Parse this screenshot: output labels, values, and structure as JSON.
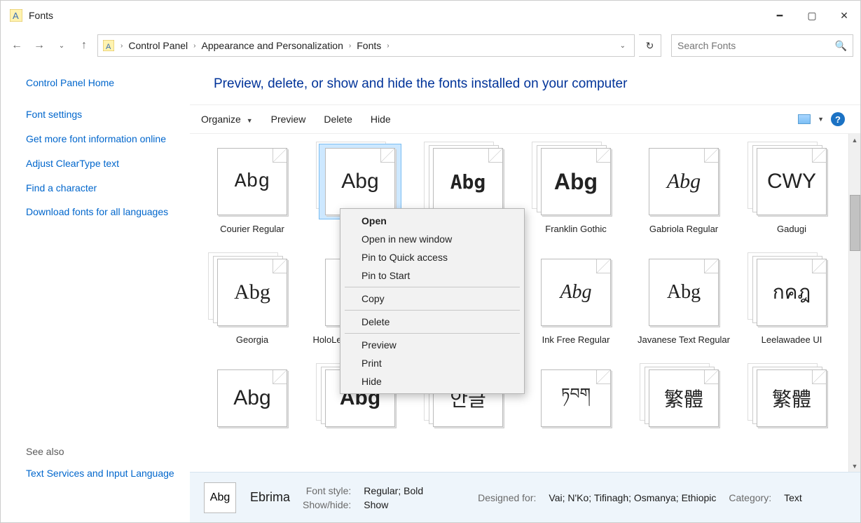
{
  "window": {
    "title": "Fonts"
  },
  "breadcrumb": {
    "items": [
      "Control Panel",
      "Appearance and Personalization",
      "Fonts"
    ]
  },
  "search": {
    "placeholder": "Search Fonts"
  },
  "sidebar": {
    "home": "Control Panel Home",
    "links": [
      "Font settings",
      "Get more font information online",
      "Adjust ClearType text",
      "Find a character",
      "Download fonts for all languages"
    ],
    "see_also_label": "See also",
    "see_also": "Text Services and Input Language"
  },
  "heading": "Preview, delete, or show and hide the fonts installed on your computer",
  "toolbar": {
    "organize": "Organize",
    "preview": "Preview",
    "delete": "Delete",
    "hide": "Hide"
  },
  "fonts_row1": [
    {
      "sample": "Abg",
      "label": "Courier Regular",
      "stack": false,
      "style": "font-family: 'Courier New', monospace; font-size:28px;"
    },
    {
      "sample": "Abg",
      "label": "",
      "stack": true,
      "selected": true,
      "style": "font-family: Arial; font-size:30px;"
    },
    {
      "sample": "Abg",
      "label": "",
      "stack": true,
      "style": "font-family: monospace; font-weight:bold; font-size:28px;"
    },
    {
      "sample": "Abg",
      "label": "Franklin Gothic",
      "stack": true,
      "style": "font-family: 'Franklin Gothic Medium', Arial; font-weight:bold; font-size:32px;"
    },
    {
      "sample": "Abg",
      "label": "Gabriola Regular",
      "stack": false,
      "style": "font-family: Gabriola, serif; font-style:italic; font-size:30px;"
    },
    {
      "sample": "CWY",
      "label": "Gadugi",
      "stack": true,
      "style": "font-family: Arial; font-size:30px;"
    }
  ],
  "fonts_row2": [
    {
      "sample": "Abg",
      "label": "Georgia",
      "stack": true,
      "style": "font-family: Georgia, serif; font-size:30px;"
    },
    {
      "sample": "A",
      "label": "HoloLens MDL2 Assets",
      "stack": false,
      "style": "font-family: Arial; font-size:30px;"
    },
    {
      "sample": "",
      "label": "",
      "stack": false,
      "style": ""
    },
    {
      "sample": "Abg",
      "label": "Ink Free Regular",
      "stack": false,
      "style": "font-family: 'Comic Sans MS', cursive; font-style:italic; font-size:28px;"
    },
    {
      "sample": "Abg",
      "label": "Javanese Text Regular",
      "stack": false,
      "style": "font-family: Georgia, serif; font-size:28px;"
    },
    {
      "sample": "กคฎ",
      "label": "Leelawadee UI",
      "stack": true,
      "style": "font-family: 'Leelawadee UI', Arial; font-size:28px;"
    }
  ],
  "fonts_row3": [
    {
      "sample": "Abg",
      "style": "font-family: Arial; font-size:30px;",
      "stack": false
    },
    {
      "sample": "Abg",
      "style": "font-family: Arial; font-weight:bold; font-size:30px;",
      "stack": true
    },
    {
      "sample": "안글",
      "style": "font-family: 'Malgun Gothic', Arial; font-size:28px;",
      "stack": true
    },
    {
      "sample": "ཏབག",
      "style": "font-family: Arial; font-size:22px;",
      "stack": false
    },
    {
      "sample": "繁體",
      "style": "font-family: 'Microsoft JhengHei', Arial; font-size:28px;",
      "stack": true
    },
    {
      "sample": "繁體",
      "style": "font-family: 'Microsoft JhengHei', Arial; font-size:28px;",
      "stack": true
    }
  ],
  "context_menu": {
    "open": "Open",
    "open_new": "Open in new window",
    "pin_qa": "Pin to Quick access",
    "pin_start": "Pin to Start",
    "copy": "Copy",
    "delete": "Delete",
    "preview": "Preview",
    "print": "Print",
    "hide": "Hide"
  },
  "details": {
    "name": "Ebrima",
    "labels": {
      "font_style": "Font style:",
      "show_hide": "Show/hide:",
      "designed_for": "Designed for:",
      "category": "Category:"
    },
    "values": {
      "font_style": "Regular; Bold",
      "show_hide": "Show",
      "designed_for": "Vai; N'Ko; Tifinagh; Osmanya; Ethiopic",
      "category": "Text"
    },
    "thumb_sample": "Abg"
  }
}
